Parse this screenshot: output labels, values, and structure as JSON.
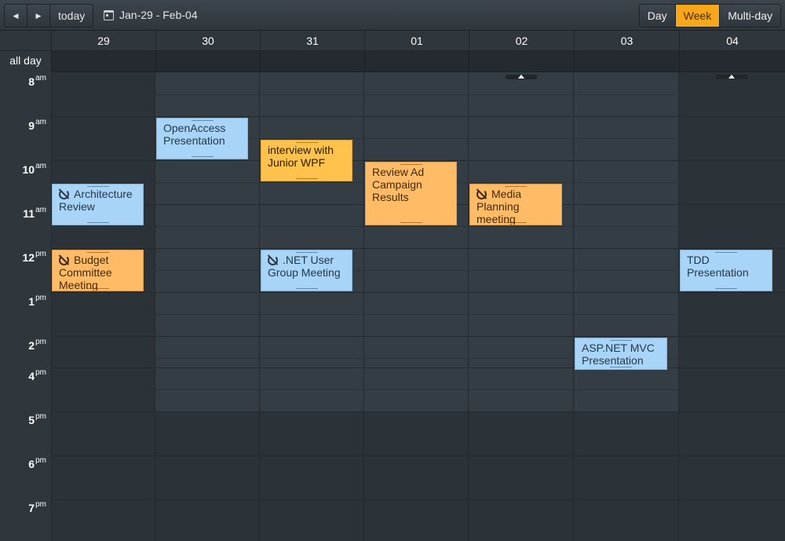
{
  "toolbar": {
    "prev_icon": "◀",
    "next_icon": "▶",
    "today_label": "today",
    "date_range": "Jan-29 - Feb-04",
    "views": [
      "Day",
      "Week",
      "Multi-day"
    ],
    "active_view": "Week",
    "accent_color": "#f8a61a"
  },
  "header": {
    "days": [
      "29",
      "30",
      "31",
      "01",
      "02",
      "03",
      "04"
    ],
    "allday_label": "all day"
  },
  "times": [
    {
      "h": "8",
      "m": "am"
    },
    {
      "h": "9",
      "m": "am"
    },
    {
      "h": "10",
      "m": "am"
    },
    {
      "h": "11",
      "m": "am"
    },
    {
      "h": "12",
      "m": "pm"
    },
    {
      "h": "1",
      "m": "pm"
    },
    {
      "h": "2",
      "m": "pm"
    },
    {
      "h": "4",
      "m": "pm"
    },
    {
      "h": "5",
      "m": "pm"
    },
    {
      "h": "6",
      "m": "pm"
    },
    {
      "h": "7",
      "m": "pm"
    }
  ],
  "events": [
    {
      "title": "OpenAccess Presentation",
      "day": "30",
      "start": "9:00",
      "end": "10:00",
      "color": "blue",
      "recurring": false
    },
    {
      "title": "interview with Junior WPF",
      "day": "31",
      "start": "9:30",
      "end": "10:30",
      "color": "yellow",
      "recurring": false
    },
    {
      "title": "Review Ad Campaign Results",
      "day": "01",
      "start": "10:00",
      "end": "11:30",
      "color": "orange",
      "recurring": false
    },
    {
      "title": "Architecture Review",
      "day": "29",
      "start": "10:30",
      "end": "11:30",
      "color": "blue",
      "recurring": true
    },
    {
      "title": "Media Planning meeting",
      "day": "02",
      "start": "10:30",
      "end": "11:30",
      "color": "orange",
      "recurring": true
    },
    {
      "title": "Budget Committee Meeting",
      "day": "29",
      "start": "12:00",
      "end": "1:00",
      "color": "orange",
      "recurring": true
    },
    {
      "title": ".NET User Group Meeting",
      "day": "31",
      "start": "12:00",
      "end": "1:00",
      "color": "blue",
      "recurring": true
    },
    {
      "title": "TDD Presentation",
      "day": "04",
      "start": "12:00",
      "end": "1:00",
      "color": "blue",
      "recurring": false
    },
    {
      "title": "ASP.NET MVC Presentation",
      "day": "03",
      "start": "2:00",
      "end": "2:45",
      "color": "blue",
      "recurring": false
    }
  ]
}
